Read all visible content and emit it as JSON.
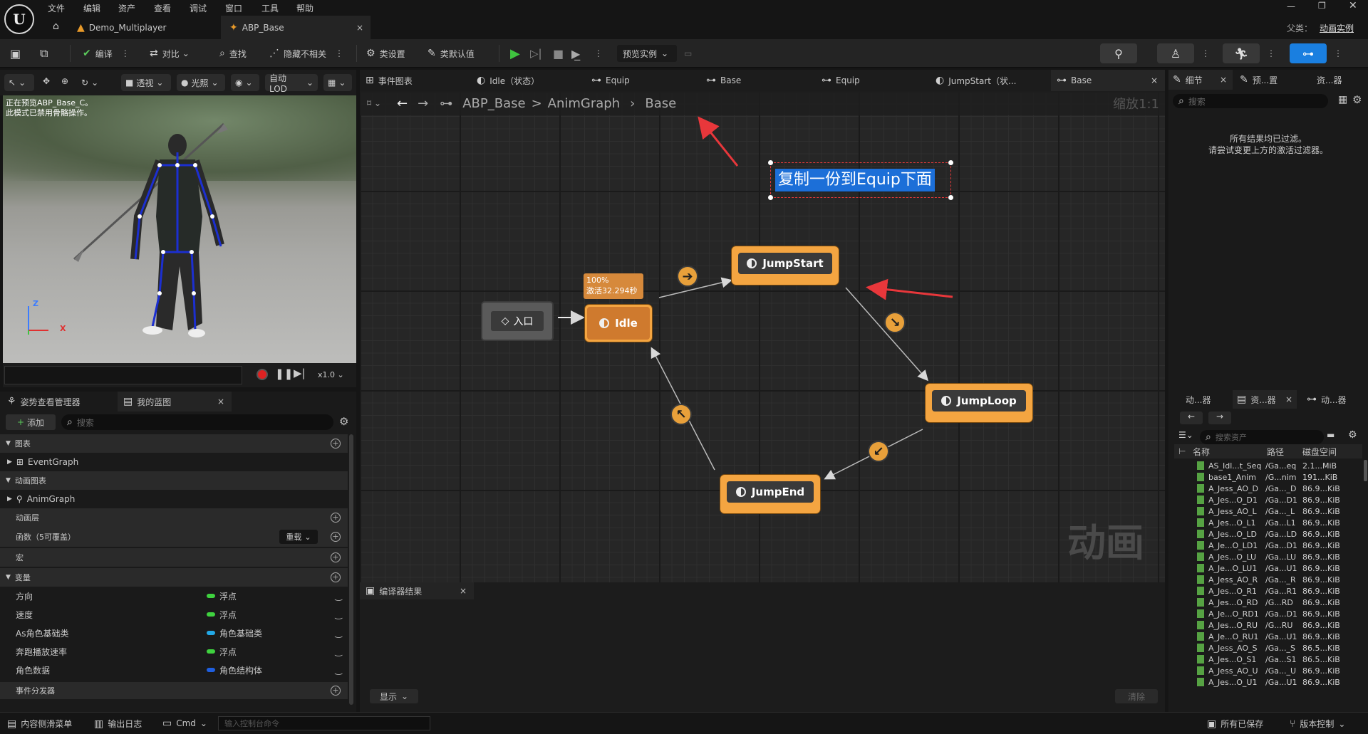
{
  "menu": [
    "文件",
    "编辑",
    "资产",
    "查看",
    "调试",
    "窗口",
    "工具",
    "帮助"
  ],
  "window": {
    "parent_label": "父类：",
    "parent_value": "动画实例"
  },
  "doc_tabs": [
    {
      "label": "Demo_Multiplayer"
    },
    {
      "label": "ABP_Base",
      "close": "×"
    }
  ],
  "toolbar": {
    "compile": "编译",
    "diff": "对比",
    "find": "查找",
    "hide_unrelated": "隐藏不相关",
    "class_settings": "类设置",
    "class_defaults": "类默认值",
    "preview_instance": "预览实例"
  },
  "viewport": {
    "perspective": "透视",
    "lighting": "光照",
    "auto_lod": "自动LOD",
    "overlay_line1": "正在预览ABP_Base_C。",
    "overlay_line2": "此模式已禁用骨骼操作。",
    "axis_z": "Z",
    "axis_x": "X",
    "speed": "x1.0"
  },
  "left_tabs": {
    "pose_manager": "姿势查看管理器",
    "my_blueprint": "我的蓝图",
    "close": "×"
  },
  "my_blueprint": {
    "add": "添加",
    "search_placeholder": "搜索",
    "graphs_header": "图表",
    "event_graph": "EventGraph",
    "anim_graphs_header": "动画图表",
    "anim_graph": "AnimGraph",
    "anim_layers_header": "动画层",
    "functions_header": "函数（5可覆盖）",
    "override_btn": "重载",
    "macros_header": "宏",
    "variables_header": "变量",
    "variables": [
      {
        "name": "方向",
        "type": "浮点",
        "color": "#3fd23f"
      },
      {
        "name": "速度",
        "type": "浮点",
        "color": "#3fd23f"
      },
      {
        "name": "As角色基础类",
        "type": "角色基础类",
        "color": "#22a8e6"
      },
      {
        "name": "奔跑播放速率",
        "type": "浮点",
        "color": "#3fd23f"
      },
      {
        "name": "角色数据",
        "type": "角色结构体",
        "color": "#1f5fe0"
      }
    ],
    "dispatchers_header": "事件分发器"
  },
  "graph_tabs": [
    {
      "label": "事件图表"
    },
    {
      "label": "Idle（状态）"
    },
    {
      "label": "Equip"
    },
    {
      "label": "Base"
    },
    {
      "label": "Equip"
    },
    {
      "label": "JumpStart（状..."
    },
    {
      "label": "Base",
      "close": "×"
    }
  ],
  "breadcrumb": {
    "root": "ABP_Base",
    "sep": ">",
    "graph": "AnimGraph",
    "current": "Base",
    "zoom": "缩放1:1"
  },
  "graph": {
    "comment": "复制一份到Equip下面",
    "entry": "入口",
    "idle_badge_line1": "100%",
    "idle_badge_line2": "激活32.294秒",
    "states": [
      "Idle",
      "JumpStart",
      "JumpLoop",
      "JumpEnd"
    ],
    "watermark": "动画"
  },
  "compiler": {
    "tab": "编译器结果",
    "close": "×",
    "show": "显示",
    "clear": "清除"
  },
  "right_tabs": {
    "details": "细节",
    "close": "×",
    "preset": "预...置",
    "assets": "资...器",
    "search_placeholder": "搜索",
    "filter_msg1": "所有结果均已过滤。",
    "filter_msg2": "请尝试变更上方的激活过滤器。"
  },
  "asset_tabs": {
    "anim": "动...器",
    "browser": "资...器",
    "close": "×",
    "anim2": "动...器",
    "search_placeholder": "搜索资产"
  },
  "asset_columns": {
    "name": "名称",
    "path": "路径",
    "size": "磁盘空间"
  },
  "assets": [
    {
      "name": "AS_Idl...t_Seq",
      "path": "/Ga...eq",
      "size": "2.1...MiB"
    },
    {
      "name": "base1_Anim",
      "path": "/G...nim",
      "size": "191...KiB"
    },
    {
      "name": "A_Jess_AO_D",
      "path": "/Ga..._D",
      "size": "86.9...KiB"
    },
    {
      "name": "A_Jes...O_D1",
      "path": "/Ga...D1",
      "size": "86.9...KiB"
    },
    {
      "name": "A_Jess_AO_L",
      "path": "/Ga..._L",
      "size": "86.9...KiB"
    },
    {
      "name": "A_Jes...O_L1",
      "path": "/Ga...L1",
      "size": "86.9...KiB"
    },
    {
      "name": "A_Jes...O_LD",
      "path": "/Ga...LD",
      "size": "86.9...KiB"
    },
    {
      "name": "A_Je...O_LD1",
      "path": "/Ga...D1",
      "size": "86.9...KiB"
    },
    {
      "name": "A_Jes...O_LU",
      "path": "/Ga...LU",
      "size": "86.9...KiB"
    },
    {
      "name": "A_Je...O_LU1",
      "path": "/Ga...U1",
      "size": "86.9...KiB"
    },
    {
      "name": "A_Jess_AO_R",
      "path": "/Ga..._R",
      "size": "86.9...KiB"
    },
    {
      "name": "A_Jes...O_R1",
      "path": "/Ga...R1",
      "size": "86.9...KiB"
    },
    {
      "name": "A_Jes...O_RD",
      "path": "/G...RD",
      "size": "86.9...KiB"
    },
    {
      "name": "A_Je...O_RD1",
      "path": "/Ga...D1",
      "size": "86.9...KiB"
    },
    {
      "name": "A_Jes...O_RU",
      "path": "/G...RU",
      "size": "86.9...KiB"
    },
    {
      "name": "A_Je...O_RU1",
      "path": "/Ga...U1",
      "size": "86.9...KiB"
    },
    {
      "name": "A_Jess_AO_S",
      "path": "/Ga..._S",
      "size": "86.5...KiB"
    },
    {
      "name": "A_Jes...O_S1",
      "path": "/Ga...S1",
      "size": "86.5...KiB"
    },
    {
      "name": "A_Jess_AO_U",
      "path": "/Ga..._U",
      "size": "86.9...KiB"
    },
    {
      "name": "A_Jes...O_U1",
      "path": "/Ga...U1",
      "size": "86.9...KiB"
    }
  ],
  "statusbar": {
    "content_drawer": "内容侧滑菜单",
    "output_log": "输出日志",
    "cmd": "Cmd",
    "console_placeholder": "输入控制台命令",
    "all_saved": "所有已保存",
    "source_control": "版本控制"
  },
  "colors": {
    "state_orange": "#f4a541",
    "accent_blue": "#1a7fe0",
    "play_green": "#3fc43f",
    "annotation_red": "#e8373b"
  }
}
